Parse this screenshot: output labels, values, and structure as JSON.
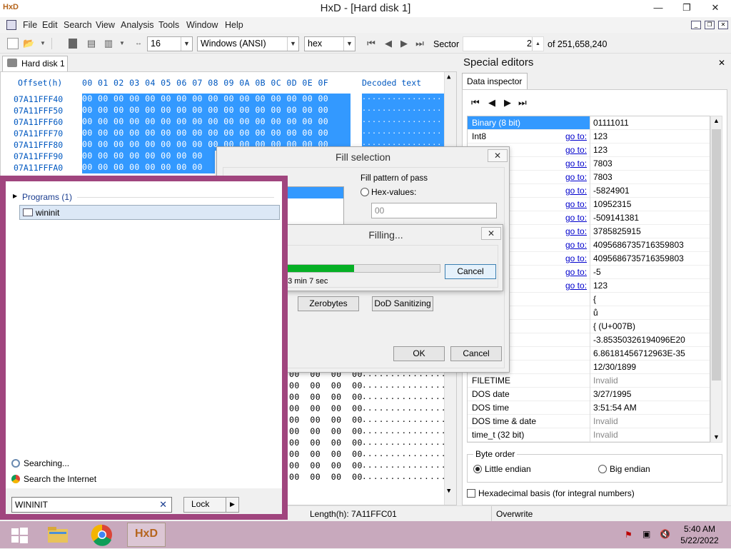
{
  "window": {
    "title": "HxD - [Hard disk 1]",
    "min": "—",
    "max": "❐",
    "close": "✕"
  },
  "menu": [
    "File",
    "Edit",
    "Search",
    "View",
    "Analysis",
    "Tools",
    "Window",
    "Help"
  ],
  "toolbar": {
    "bytes_per_row": "16",
    "charset": "Windows (ANSI)",
    "display": "hex",
    "sector_label": "Sector",
    "sector_value": "2",
    "sector_total": "of 251,658,240"
  },
  "hex": {
    "tab": "Hard disk 1",
    "offset_header": "Offset(h)",
    "columns": "00 01 02 03 04 05 06 07 08 09 0A 0B 0C 0D 0E 0F",
    "decoded_header": "Decoded text",
    "offsets": [
      "07A11FFF40",
      "07A11FFF50",
      "07A11FFF60",
      "07A11FFF70",
      "07A11FFF80",
      "07A11FFF90",
      "07A11FFFA0"
    ],
    "row_bytes_full": "00 00 00 00 00 00 00 00 00 00 00 00 00 00 00 00",
    "row_bytes_partial": "00 00 00 00 00 00 00 00",
    "row_bytes_tail": "00  00  00  00",
    "decoded_dots": "................"
  },
  "status": {
    "length": "Length(h): 7A11FFC01",
    "mode": "Overwrite"
  },
  "special": {
    "title": "Special editors",
    "tab": "Data inspector",
    "goto": "go to:",
    "rows": [
      {
        "name": "Binary (8 bit)",
        "goto": false,
        "value": "01111011"
      },
      {
        "name": "Int8",
        "goto": true,
        "value": "123"
      },
      {
        "name": "",
        "goto": true,
        "value": "123"
      },
      {
        "name": "",
        "goto": true,
        "value": "7803"
      },
      {
        "name": "",
        "goto": true,
        "value": "7803"
      },
      {
        "name": "",
        "goto": true,
        "value": "-5824901"
      },
      {
        "name": "",
        "goto": true,
        "value": "10952315"
      },
      {
        "name": "",
        "goto": true,
        "value": "-509141381"
      },
      {
        "name": "",
        "goto": true,
        "value": "3785825915"
      },
      {
        "name": "",
        "goto": true,
        "value": "4095686735716359803"
      },
      {
        "name": "",
        "goto": true,
        "value": "4095686735716359803"
      },
      {
        "name": "",
        "goto": true,
        "value": "-5"
      },
      {
        "name": "",
        "goto": true,
        "value": "123"
      },
      {
        "name": "char8_t",
        "goto": false,
        "value": "{"
      },
      {
        "name": "char16_t",
        "goto": false,
        "value": "ů"
      },
      {
        "name": "point",
        "goto": false,
        "value": "{ (U+007B)"
      },
      {
        "name": "32)",
        "goto": false,
        "value": "-3.85350326194096E20"
      },
      {
        "name": "at64)",
        "goto": false,
        "value": "6.86181456712963E-35"
      },
      {
        "name": "",
        "goto": false,
        "value": "12/30/1899"
      },
      {
        "name": "FILETIME",
        "goto": false,
        "value": "Invalid"
      },
      {
        "name": "DOS date",
        "goto": false,
        "value": "3/27/1995"
      },
      {
        "name": "DOS time",
        "goto": false,
        "value": "3:51:54 AM"
      },
      {
        "name": "DOS time & date",
        "goto": false,
        "value": "Invalid"
      },
      {
        "name": "time_t (32 bit)",
        "goto": false,
        "value": "Invalid"
      }
    ],
    "byte_order_label": "Byte order",
    "little_endian": "Little endian",
    "big_endian": "Big endian",
    "hex_basis": "Hexadecimal basis (for integral numbers)"
  },
  "fill_dialog": {
    "title": "Fill selection",
    "pattern_label": "Fill pattern of pass",
    "hex_values_label": "Hex-values:",
    "hex_value": "00",
    "zerobytes": "Zerobytes",
    "dod": "DoD Sanitizing",
    "ok": "OK",
    "cancel": "Cancel"
  },
  "filling_dialog": {
    "title": "Filling...",
    "time_left": ": 3 min 7 sec",
    "progress": 0.45,
    "cancel": "Cancel"
  },
  "start_search": {
    "group": "Programs (1)",
    "result": "wininit",
    "searching": "Searching...",
    "search_internet": "Search the Internet",
    "query": "WININIT",
    "lock": "Lock"
  },
  "tray": {
    "time": "5:40 AM",
    "date": "5/22/2022"
  },
  "colors": {
    "selection": "#3399ff",
    "start_border": "#a0457e",
    "taskbar": "#c8a9bd",
    "progress": "#06b025"
  }
}
